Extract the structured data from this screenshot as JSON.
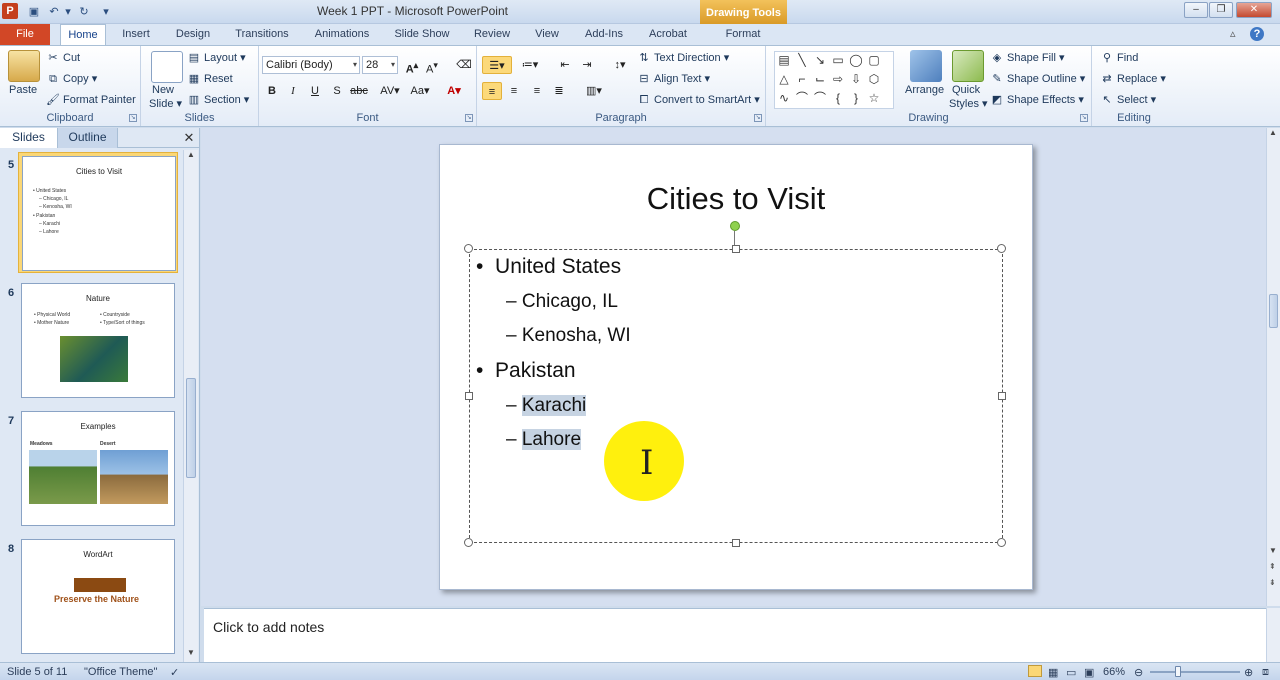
{
  "window": {
    "title": "Week 1 PPT - Microsoft PowerPoint",
    "contextual_tab_group": "Drawing Tools",
    "app_icon": "P"
  },
  "tabs": {
    "file": "File",
    "items": [
      "Home",
      "Insert",
      "Design",
      "Transitions",
      "Animations",
      "Slide Show",
      "Review",
      "View",
      "Add-Ins",
      "Acrobat",
      "Format"
    ]
  },
  "ribbon": {
    "clipboard": {
      "label": "Clipboard",
      "paste": "Paste",
      "cut": "Cut",
      "copy": "Copy",
      "format_painter": "Format Painter"
    },
    "slides": {
      "label": "Slides",
      "new_slide_1": "New",
      "new_slide_2": "Slide",
      "layout": "Layout",
      "reset": "Reset",
      "section": "Section"
    },
    "font": {
      "label": "Font",
      "name": "Calibri (Body)",
      "size": "28"
    },
    "paragraph": {
      "label": "Paragraph",
      "text_direction": "Text Direction",
      "align_text": "Align Text",
      "convert": "Convert to SmartArt"
    },
    "drawing": {
      "label": "Drawing",
      "arrange": "Arrange",
      "quick_styles_1": "Quick",
      "quick_styles_2": "Styles",
      "shape_fill": "Shape Fill",
      "shape_outline": "Shape Outline",
      "shape_effects": "Shape Effects"
    },
    "editing": {
      "label": "Editing",
      "find": "Find",
      "replace": "Replace",
      "select": "Select"
    }
  },
  "left_pane": {
    "tab_slides": "Slides",
    "tab_outline": "Outline",
    "thumbnails": [
      {
        "num": "5",
        "title": "Cities to Visit",
        "lines": [
          "• United States",
          "– Chicago, IL",
          "– Kenosha, WI",
          "• Pakistan",
          "– Karachi",
          "– Lahore"
        ]
      },
      {
        "num": "6",
        "title": "Nature",
        "lines": [
          "• Physical World",
          "• Mother Nature",
          "• Countryside",
          "• Type/Sort of things"
        ]
      },
      {
        "num": "7",
        "title": "Examples",
        "lines": [
          "Meadows",
          "Desert"
        ]
      },
      {
        "num": "8",
        "title": "WordArt",
        "lines": [
          "Preserve the Nature"
        ]
      }
    ]
  },
  "slide": {
    "title": "Cities to Visit",
    "bullets": [
      {
        "text": "United States",
        "level": 1
      },
      {
        "text": "Chicago, IL",
        "level": 2
      },
      {
        "text": "Kenosha, WI",
        "level": 2
      },
      {
        "text": "Pakistan",
        "level": 1
      },
      {
        "text": "Karachi",
        "level": 2,
        "selected": true
      },
      {
        "text": "Lahore",
        "level": 2,
        "selected": true
      }
    ]
  },
  "notes": {
    "placeholder": "Click to add notes"
  },
  "status": {
    "slide_position": "Slide 5 of 11",
    "theme": "\"Office Theme\"",
    "zoom": "66%"
  },
  "colors": {
    "file_tab": "#d24726",
    "selection": "#c6d3e2",
    "cursor_highlight": "#ffef00",
    "thumbnail_selected": "#fbd776"
  }
}
